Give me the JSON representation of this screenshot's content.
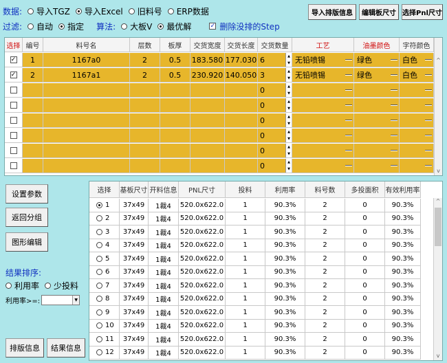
{
  "row1": {
    "label": "数据:",
    "options": [
      {
        "label": "导入TGZ",
        "selected": false
      },
      {
        "label": "导入Excel",
        "selected": true
      },
      {
        "label": "旧料号",
        "selected": false
      },
      {
        "label": "ERP数据",
        "selected": false
      }
    ]
  },
  "row2": {
    "filter_label": "过滤:",
    "filter_options": [
      {
        "label": "自动",
        "selected": false
      },
      {
        "label": "指定",
        "selected": true
      }
    ],
    "algo_label": "算法:",
    "algo_options": [
      {
        "label": "大板V",
        "selected": false
      },
      {
        "label": "最优解",
        "selected": true
      }
    ],
    "delete_checkbox": {
      "label": "删除没排的Step",
      "checked": true
    }
  },
  "toolbar": {
    "import_info": "导入排版信息",
    "edit_size": "编辑板尺寸",
    "select_pnl": "选择Pnl尺寸"
  },
  "upper_table": {
    "headers": [
      "选择",
      "编号",
      "料号名",
      "层数",
      "板厚",
      "交货宽度",
      "交货长度",
      "交货数量",
      "工艺",
      "油墨颜色",
      "字符颜色"
    ],
    "rows": [
      {
        "checked": true,
        "no": "1",
        "name": "1167a0",
        "layers": "2",
        "thickness": "0.5",
        "width": "183.580",
        "length": "177.030",
        "qty": "6",
        "process": "无铅喷锡",
        "ink": "绿色",
        "char": "白色"
      },
      {
        "checked": true,
        "no": "2",
        "name": "1167a1",
        "layers": "2",
        "thickness": "0.5",
        "width": "230.920",
        "length": "140.050",
        "qty": "3",
        "process": "无铅喷锡",
        "ink": "绿色",
        "char": "白色"
      },
      {
        "checked": false,
        "no": "",
        "name": "",
        "layers": "",
        "thickness": "",
        "width": "",
        "length": "",
        "qty": "0",
        "process": "",
        "ink": "",
        "char": ""
      },
      {
        "checked": false,
        "no": "",
        "name": "",
        "layers": "",
        "thickness": "",
        "width": "",
        "length": "",
        "qty": "0",
        "process": "",
        "ink": "",
        "char": ""
      },
      {
        "checked": false,
        "no": "",
        "name": "",
        "layers": "",
        "thickness": "",
        "width": "",
        "length": "",
        "qty": "0",
        "process": "",
        "ink": "",
        "char": ""
      },
      {
        "checked": false,
        "no": "",
        "name": "",
        "layers": "",
        "thickness": "",
        "width": "",
        "length": "",
        "qty": "0",
        "process": "",
        "ink": "",
        "char": ""
      },
      {
        "checked": false,
        "no": "",
        "name": "",
        "layers": "",
        "thickness": "",
        "width": "",
        "length": "",
        "qty": "0",
        "process": "",
        "ink": "",
        "char": ""
      },
      {
        "checked": false,
        "no": "",
        "name": "",
        "layers": "",
        "thickness": "",
        "width": "",
        "length": "",
        "qty": "0",
        "process": "",
        "ink": "",
        "char": ""
      }
    ]
  },
  "left_panel": {
    "settings": "设置参数",
    "back": "返回分组",
    "graph_edit": "图形编辑",
    "sort_label": "结果排序:",
    "sort_options": [
      {
        "label": "利用率",
        "selected": false
      },
      {
        "label": "少投料",
        "selected": false
      }
    ],
    "rate_label": "利用率>=:",
    "rate_value": "",
    "layout_info": "排版信息",
    "result_info": "结果信息"
  },
  "lower_table": {
    "headers": [
      "选择",
      "基板尺寸",
      "开料信息",
      "PNL尺寸",
      "投料",
      "利用率",
      "料号数",
      "多投面积",
      "有效利用率"
    ],
    "rows": [
      {
        "sel": true,
        "no": "1",
        "base": "37x49",
        "cut": "1裁4",
        "pnl": "520.0x622.0",
        "feed": "1",
        "rate": "90.3%",
        "parts": "2",
        "extra": "0",
        "eff": "90.3%"
      },
      {
        "sel": false,
        "no": "2",
        "base": "37x49",
        "cut": "1裁4",
        "pnl": "520.0x622.0",
        "feed": "1",
        "rate": "90.3%",
        "parts": "2",
        "extra": "0",
        "eff": "90.3%"
      },
      {
        "sel": false,
        "no": "3",
        "base": "37x49",
        "cut": "1裁4",
        "pnl": "520.0x622.0",
        "feed": "1",
        "rate": "90.3%",
        "parts": "2",
        "extra": "0",
        "eff": "90.3%"
      },
      {
        "sel": false,
        "no": "4",
        "base": "37x49",
        "cut": "1裁4",
        "pnl": "520.0x622.0",
        "feed": "1",
        "rate": "90.3%",
        "parts": "2",
        "extra": "0",
        "eff": "90.3%"
      },
      {
        "sel": false,
        "no": "5",
        "base": "37x49",
        "cut": "1裁4",
        "pnl": "520.0x622.0",
        "feed": "1",
        "rate": "90.3%",
        "parts": "2",
        "extra": "0",
        "eff": "90.3%"
      },
      {
        "sel": false,
        "no": "6",
        "base": "37x49",
        "cut": "1裁4",
        "pnl": "520.0x622.0",
        "feed": "1",
        "rate": "90.3%",
        "parts": "2",
        "extra": "0",
        "eff": "90.3%"
      },
      {
        "sel": false,
        "no": "7",
        "base": "37x49",
        "cut": "1裁4",
        "pnl": "520.0x622.0",
        "feed": "1",
        "rate": "90.3%",
        "parts": "2",
        "extra": "0",
        "eff": "90.3%"
      },
      {
        "sel": false,
        "no": "8",
        "base": "37x49",
        "cut": "1裁4",
        "pnl": "520.0x622.0",
        "feed": "1",
        "rate": "90.3%",
        "parts": "2",
        "extra": "0",
        "eff": "90.3%"
      },
      {
        "sel": false,
        "no": "9",
        "base": "37x49",
        "cut": "1裁4",
        "pnl": "520.0x622.0",
        "feed": "1",
        "rate": "90.3%",
        "parts": "2",
        "extra": "0",
        "eff": "90.3%"
      },
      {
        "sel": false,
        "no": "10",
        "base": "37x49",
        "cut": "1裁4",
        "pnl": "520.0x622.0",
        "feed": "1",
        "rate": "90.3%",
        "parts": "2",
        "extra": "0",
        "eff": "90.3%"
      },
      {
        "sel": false,
        "no": "11",
        "base": "37x49",
        "cut": "1裁4",
        "pnl": "520.0x622.0",
        "feed": "1",
        "rate": "90.3%",
        "parts": "2",
        "extra": "0",
        "eff": "90.3%"
      },
      {
        "sel": false,
        "no": "12",
        "base": "37x49",
        "cut": "1裁4",
        "pnl": "520.0x622.0",
        "feed": "1",
        "rate": "90.3%",
        "parts": "2",
        "extra": "0",
        "eff": "90.3%"
      }
    ]
  },
  "colors": {
    "row_yellow": "#e7b62b",
    "bg": "#aee6ea",
    "label_blue": "#1030c0",
    "header_red": "#d01010"
  }
}
